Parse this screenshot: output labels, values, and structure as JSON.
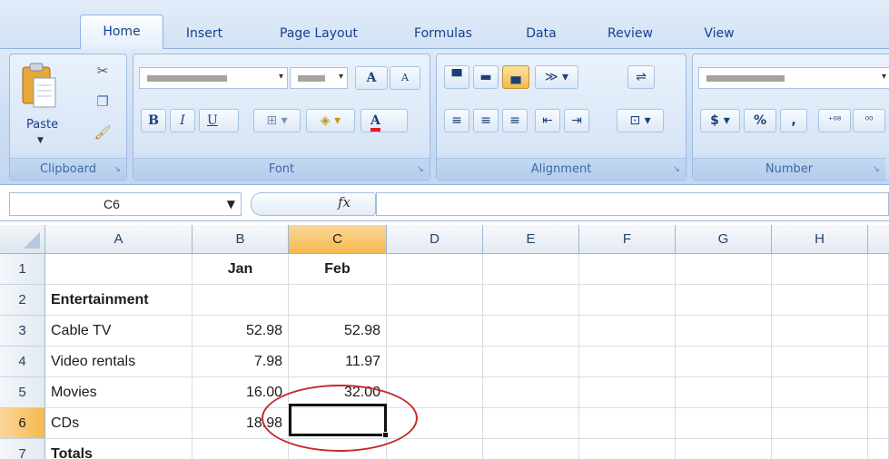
{
  "tabs": [
    "Home",
    "Insert",
    "Page Layout",
    "Formulas",
    "Data",
    "Review",
    "View"
  ],
  "active_tab": "Home",
  "ribbon": {
    "groups": {
      "clipboard": "Clipboard",
      "font": "Font",
      "alignment": "Alignment",
      "number": "Number"
    },
    "paste_label": "Paste",
    "bold_label": "B",
    "italic_label": "I",
    "underline_label": "U",
    "grow_font_label": "A",
    "shrink_font_label": "A",
    "font_color_label": "A",
    "currency_label": "$",
    "percent_label": "%",
    "comma_label": ","
  },
  "formula_bar": {
    "name_box": "C6",
    "fx_label": "fx",
    "formula": ""
  },
  "grid": {
    "columns": [
      "A",
      "B",
      "C",
      "D",
      "E",
      "F",
      "G",
      "H"
    ],
    "selected_column": "C",
    "rows": [
      "1",
      "2",
      "3",
      "4",
      "5",
      "6",
      "7"
    ],
    "selected_row": "6",
    "cells": {
      "B1": "Jan",
      "C1": "Feb",
      "A2": "Entertainment",
      "A3": "Cable TV",
      "B3": "52.98",
      "C3": "52.98",
      "A4": "Video rentals",
      "B4": "7.98",
      "C4": "11.97",
      "A5": "Movies",
      "B5": "16.00",
      "C5": "32.00",
      "A6": "CDs",
      "B6": "18.98",
      "A7": "Totals"
    },
    "active_cell": "C6"
  },
  "colors": {
    "selected_header": "#f5b94e",
    "annotation_circle": "#c22b2b",
    "ribbon_text": "#15428b"
  }
}
